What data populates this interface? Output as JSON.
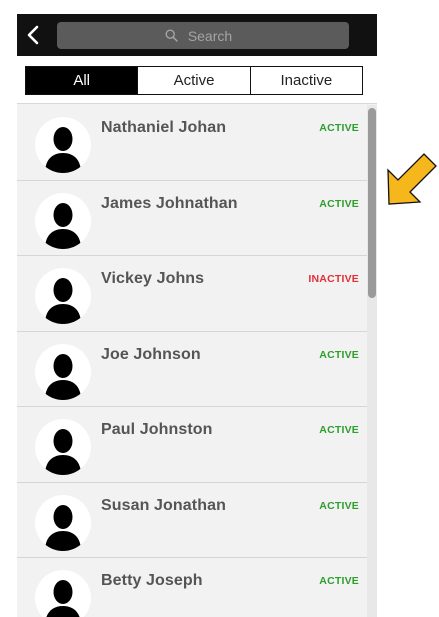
{
  "search": {
    "placeholder": "Search"
  },
  "tabs": [
    {
      "label": "All",
      "selected": true
    },
    {
      "label": "Active",
      "selected": false
    },
    {
      "label": "Inactive",
      "selected": false
    }
  ],
  "contacts": [
    {
      "name": "Nathaniel Johan",
      "status": "ACTIVE"
    },
    {
      "name": "James Johnathan",
      "status": "ACTIVE"
    },
    {
      "name": "Vickey Johns",
      "status": "INACTIVE"
    },
    {
      "name": "Joe Johnson",
      "status": "ACTIVE"
    },
    {
      "name": "Paul Johnston",
      "status": "ACTIVE"
    },
    {
      "name": "Susan Jonathan",
      "status": "ACTIVE"
    },
    {
      "name": "Betty Joseph",
      "status": "ACTIVE"
    }
  ],
  "colors": {
    "active": "#2e9e2e",
    "inactive": "#e0303a",
    "arrow_fill": "#f5b71b"
  },
  "icons": {
    "back": "chevron-left-icon",
    "search": "search-icon",
    "avatar": "person-silhouette-icon",
    "pointer": "arrow-pointer-icon"
  }
}
